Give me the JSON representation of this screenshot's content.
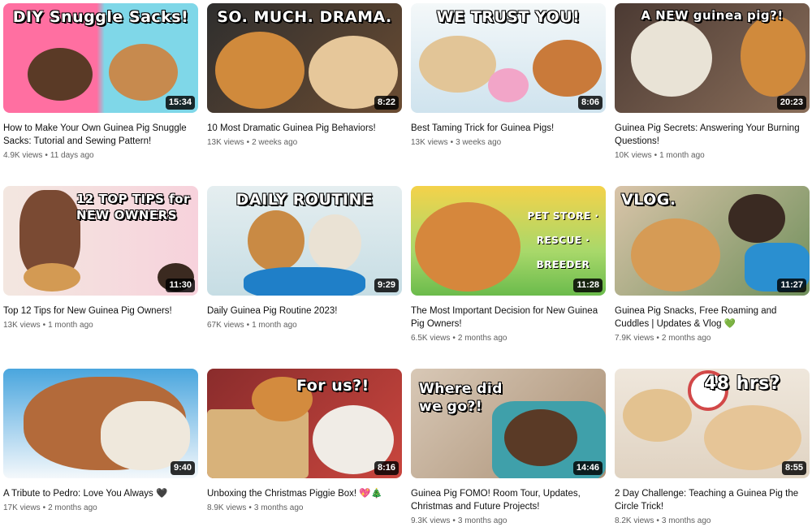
{
  "videos": [
    {
      "title": "How to Make Your Own Guinea Pig Snuggle Sacks: Tutorial and Sewing Pattern!",
      "views": "4.9K views",
      "age": "11 days ago",
      "duration": "15:34",
      "thumb_text": "DIY Snuggle Sacks!",
      "colors": [
        "#ff6fa1",
        "#7fd7e8"
      ]
    },
    {
      "title": "10 Most Dramatic Guinea Pig Behaviors!",
      "views": "13K views",
      "age": "2 weeks ago",
      "duration": "8:22",
      "thumb_text": "SO. MUCH. DRAMA.",
      "colors": [
        "#3b3b3b",
        "#7a5a3a"
      ]
    },
    {
      "title": "Best Taming Trick for Guinea Pigs!",
      "views": "13K views",
      "age": "3 weeks ago",
      "duration": "8:06",
      "thumb_text": "WE TRUST YOU!",
      "colors": [
        "#cfe7f2",
        "#e8f4f8"
      ]
    },
    {
      "title": "Guinea Pig Secrets: Answering Your Burning Questions!",
      "views": "10K views",
      "age": "1 month ago",
      "duration": "20:23",
      "thumb_text": "A NEW guinea pig?!",
      "colors": [
        "#6a4a3a",
        "#8c6a50"
      ]
    },
    {
      "title": "Top 12 Tips for New Guinea Pig Owners!",
      "views": "13K views",
      "age": "1 month ago",
      "duration": "11:30",
      "thumb_text": "12 TOP TIPS for NEW OWNERS",
      "colors": [
        "#f6d7dd",
        "#e9b9c4"
      ]
    },
    {
      "title": "Daily Guinea Pig Routine 2023!",
      "views": "67K views",
      "age": "1 month ago",
      "duration": "9:29",
      "thumb_text": "DAILY ROUTINE",
      "colors": [
        "#9ecbd8",
        "#cfe8ee"
      ]
    },
    {
      "title": "The Most Important Decision for New Guinea Pig Owners!",
      "views": "6.5K views",
      "age": "2 months ago",
      "duration": "11:28",
      "thumb_text": "PET STORE · RESCUE · BREEDER",
      "colors": [
        "#79c95c",
        "#f6cf3f"
      ]
    },
    {
      "title": "Guinea Pig Snacks, Free Roaming and Cuddles | Updates & Vlog 💚",
      "views": "7.9K views",
      "age": "2 months ago",
      "duration": "11:27",
      "thumb_text": "VLOG.",
      "colors": [
        "#5e8f6a",
        "#8a6a55"
      ]
    },
    {
      "title": "A Tribute to Pedro: Love You Always 🖤",
      "views": "17K views",
      "age": "2 months ago",
      "duration": "9:40",
      "thumb_text": "",
      "colors": [
        "#5bb4e6",
        "#e9f4fb"
      ]
    },
    {
      "title": "Unboxing the Christmas Piggie Box! 💖🎄",
      "views": "8.9K views",
      "age": "3 months ago",
      "duration": "8:16",
      "thumb_text": "For us?!",
      "colors": [
        "#b23b3b",
        "#d7a86e"
      ]
    },
    {
      "title": "Guinea Pig FOMO! Room Tour, Updates, Christmas and Future Projects!",
      "views": "9.3K views",
      "age": "3 months ago",
      "duration": "14:46",
      "thumb_text": "Where did we go?!",
      "colors": [
        "#5aa0a8",
        "#d9c7b5"
      ]
    },
    {
      "title": "2 Day Challenge: Teaching a Guinea Pig the Circle Trick!",
      "views": "8.2K views",
      "age": "3 months ago",
      "duration": "8:55",
      "thumb_text": "48 hrs?",
      "colors": [
        "#e9e2d6",
        "#d24848"
      ]
    }
  ]
}
